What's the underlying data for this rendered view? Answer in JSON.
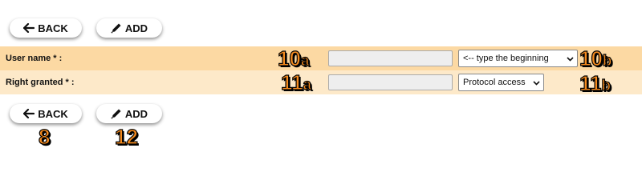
{
  "toolbar_top": {
    "back_label": "BACK",
    "add_label": "ADD"
  },
  "form": {
    "user_name": {
      "label": "User name * :",
      "input_value": "",
      "select_value": "<-- type the beginning"
    },
    "right_granted": {
      "label": "Right granted * :",
      "input_value": "",
      "select_value": "Protocol access"
    }
  },
  "toolbar_bottom": {
    "back_label": "BACK",
    "add_label": "ADD"
  },
  "markers": {
    "m10a_num": "10",
    "m10a_sub": "a",
    "m10b_num": "10",
    "m10b_sub": "b",
    "m11a_num": "11",
    "m11a_sub": "a",
    "m11b_num": "11",
    "m11b_sub": "b",
    "m8": "8",
    "m12": "12"
  },
  "colors": {
    "row_primary": "#fcd9a3",
    "row_secondary": "#fde9c9",
    "marker": "#f48a1e"
  },
  "icons": {
    "back": "arrow-left-icon",
    "add": "pencil-icon",
    "select_caret": "chevron-down-icon"
  }
}
